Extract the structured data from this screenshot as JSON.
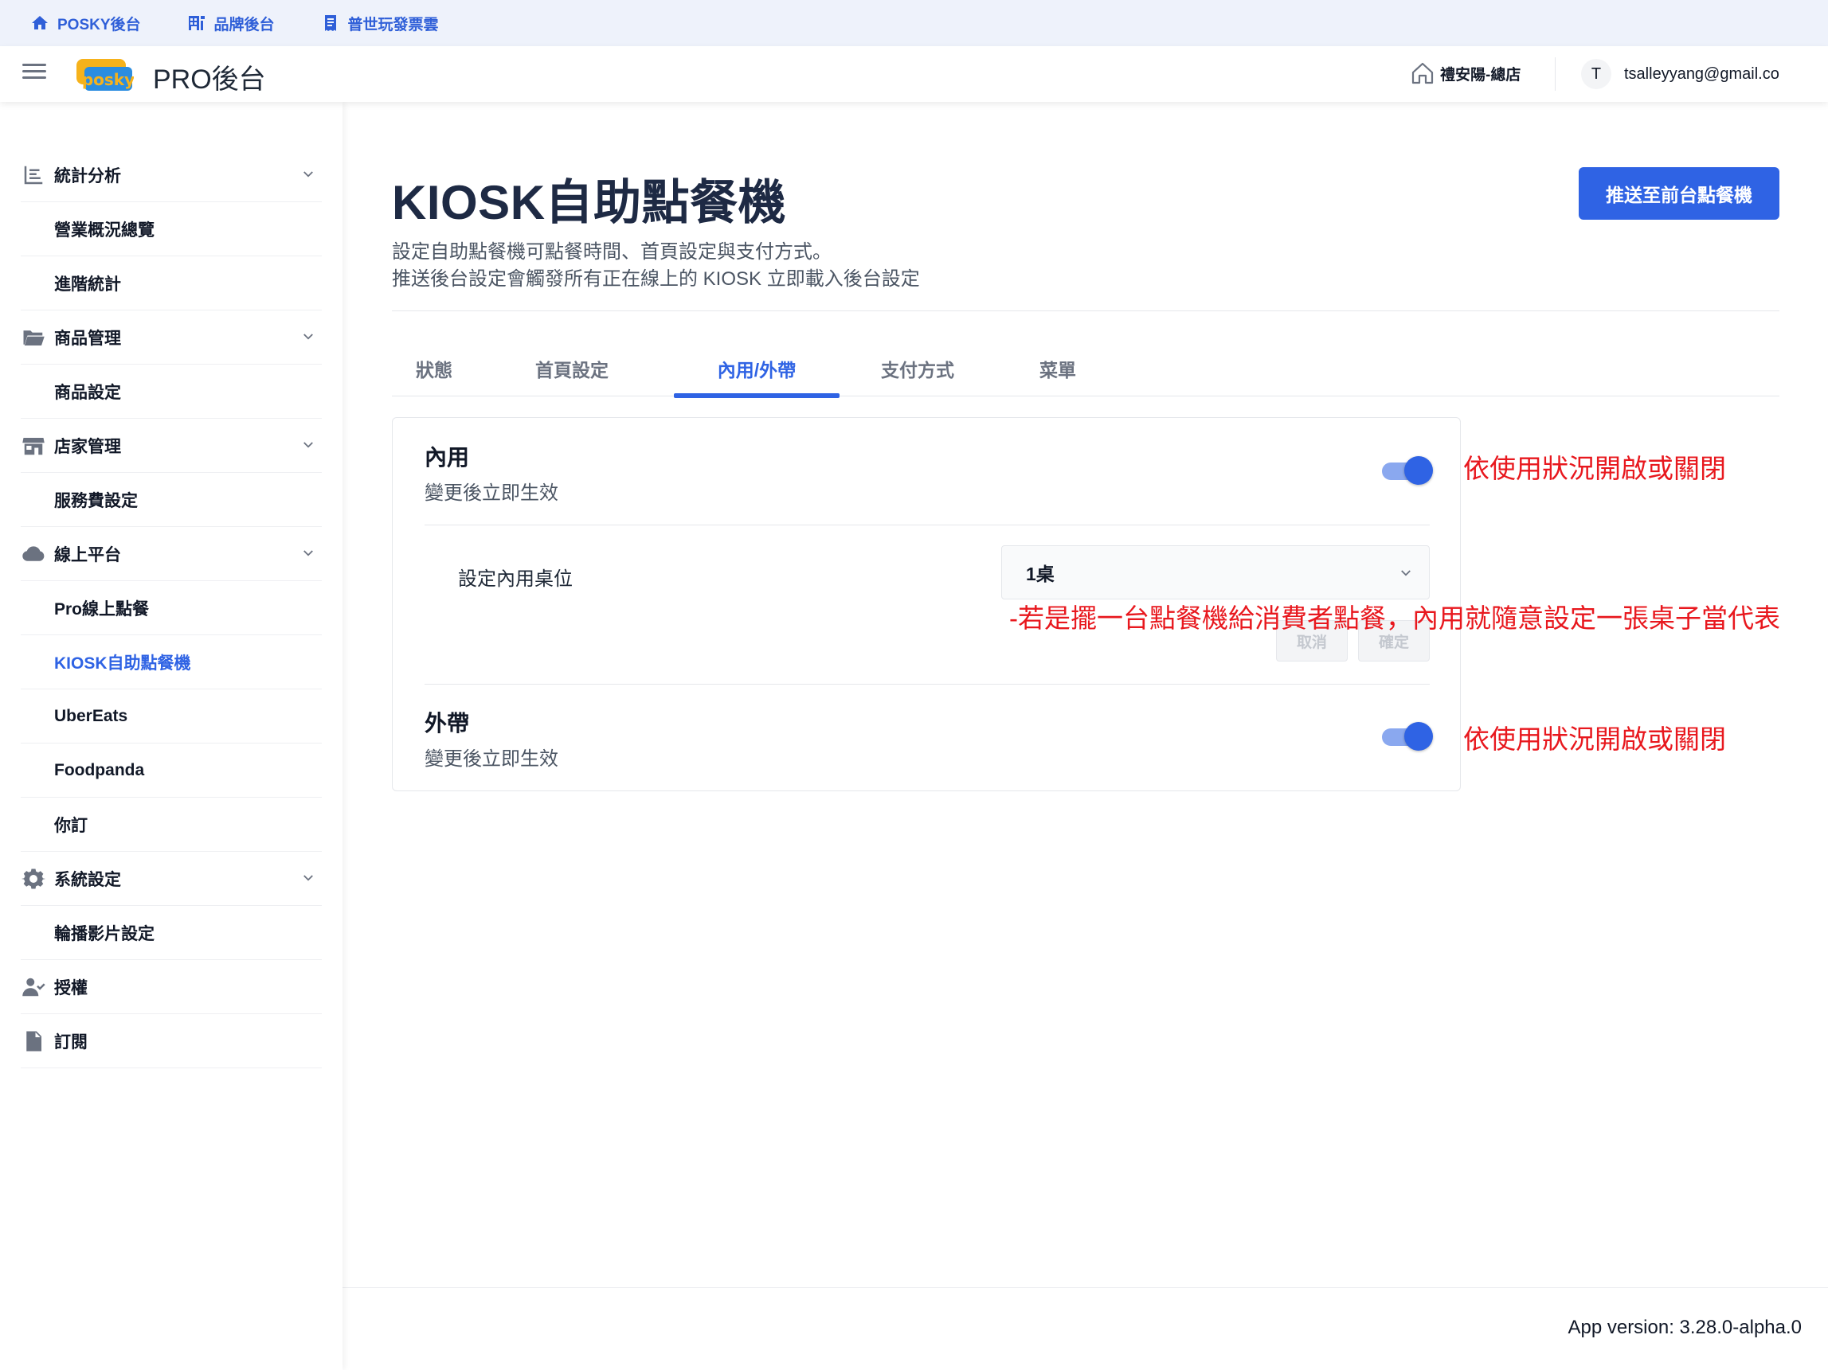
{
  "top_links": [
    {
      "label": "POSKY後台",
      "icon": "home-icon"
    },
    {
      "label": "品牌後台",
      "icon": "brand-icon"
    },
    {
      "label": "普世玩發票雲",
      "icon": "invoice-icon"
    }
  ],
  "header": {
    "app_title": "PRO後台",
    "logo_text": "posky",
    "store_name": "禮安陽-總店",
    "avatar_initial": "T",
    "user_email": "tsalleyyang@gmail.co"
  },
  "sidebar": {
    "items": [
      {
        "label": "統計分析",
        "icon": "chart-icon",
        "group": true
      },
      {
        "label": "營業概況總覽"
      },
      {
        "label": "進階統計"
      },
      {
        "label": "商品管理",
        "icon": "folder-icon",
        "group": true
      },
      {
        "label": "商品設定"
      },
      {
        "label": "店家管理",
        "icon": "store-icon",
        "group": true
      },
      {
        "label": "服務費設定"
      },
      {
        "label": "線上平台",
        "icon": "cloud-icon",
        "group": true
      },
      {
        "label": "Pro線上點餐"
      },
      {
        "label": "KIOSK自助點餐機",
        "active": true
      },
      {
        "label": "UberEats"
      },
      {
        "label": "Foodpanda"
      },
      {
        "label": "你訂"
      },
      {
        "label": "系統設定",
        "icon": "gear-icon",
        "group": true
      },
      {
        "label": "輪播影片設定"
      },
      {
        "label": "授權",
        "icon": "user-check-icon"
      },
      {
        "label": "訂閱",
        "icon": "document-icon"
      }
    ]
  },
  "main": {
    "title": "KIOSK自助點餐機",
    "description_line1": "設定自助點餐機可點餐時間、首頁設定與支付方式。",
    "description_line2": "推送後台設定會觸發所有正在線上的 KIOSK 立即載入後台設定",
    "push_button": "推送至前台點餐機",
    "tabs": [
      {
        "label": "狀態"
      },
      {
        "label": "首頁設定"
      },
      {
        "label": "內用/外帶",
        "active": true
      },
      {
        "label": "支付方式"
      },
      {
        "label": "菜單"
      }
    ],
    "dine_in": {
      "title": "內用",
      "subtitle": "變更後立即生效",
      "enabled": true,
      "table_label": "設定內用桌位",
      "table_value": "1桌",
      "cancel_label": "取消",
      "confirm_label": "確定"
    },
    "takeout": {
      "title": "外帶",
      "subtitle": "變更後立即生效",
      "enabled": true
    }
  },
  "annotations": {
    "dine_in_note": "依使用狀況開啟或關閉",
    "table_note": "-若是擺一台點餐機給消費者點餐，內用就隨意設定一張桌子當代表",
    "takeout_note": "依使用狀況開啟或關閉"
  },
  "footer": {
    "version": "App version: 3.28.0-alpha.0"
  },
  "colors": {
    "accent": "#2f63e4",
    "annotation": "#e8181e",
    "topbar_bg": "#eef2fb"
  }
}
